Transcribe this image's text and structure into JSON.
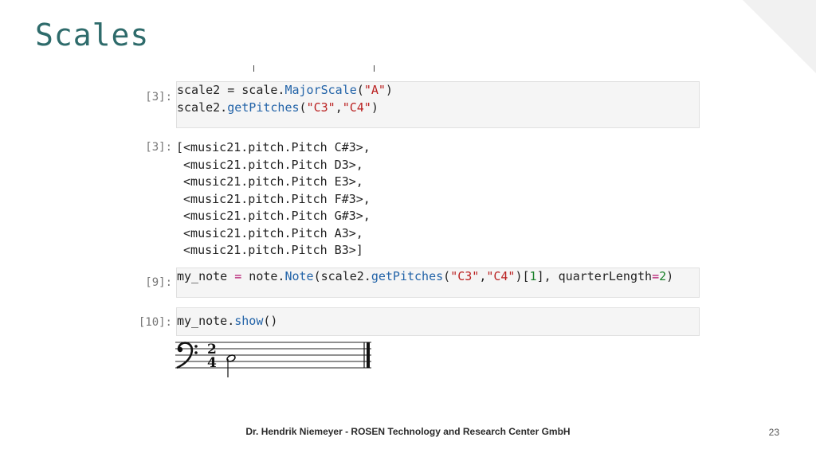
{
  "slide": {
    "title": "Scales",
    "footer": "Dr. Hendrik Niemeyer - ROSEN Technology and Research Center GmbH",
    "page_number": "23"
  },
  "cells": [
    {
      "prompt": "[3]:",
      "type": "input",
      "lines": [
        [
          {
            "t": "scale2 = scale.",
            "c": ""
          },
          {
            "t": "MajorScale",
            "c": "kw"
          },
          {
            "t": "(",
            "c": ""
          },
          {
            "t": "\"A\"",
            "c": "str"
          },
          {
            "t": ")",
            "c": ""
          }
        ],
        [
          {
            "t": "scale2.",
            "c": ""
          },
          {
            "t": "getPitches",
            "c": "kw"
          },
          {
            "t": "(",
            "c": ""
          },
          {
            "t": "\"C3\"",
            "c": "str"
          },
          {
            "t": ",",
            "c": ""
          },
          {
            "t": "\"C4\"",
            "c": "str"
          },
          {
            "t": ")",
            "c": ""
          }
        ]
      ]
    },
    {
      "prompt": "[3]:",
      "type": "output",
      "lines": [
        [
          {
            "t": "[<music21.pitch.Pitch C#3>,",
            "c": ""
          }
        ],
        [
          {
            "t": " <music21.pitch.Pitch D3>,",
            "c": ""
          }
        ],
        [
          {
            "t": " <music21.pitch.Pitch E3>,",
            "c": ""
          }
        ],
        [
          {
            "t": " <music21.pitch.Pitch F#3>,",
            "c": ""
          }
        ],
        [
          {
            "t": " <music21.pitch.Pitch G#3>,",
            "c": ""
          }
        ],
        [
          {
            "t": " <music21.pitch.Pitch A3>,",
            "c": ""
          }
        ],
        [
          {
            "t": " <music21.pitch.Pitch B3>]",
            "c": ""
          }
        ]
      ]
    },
    {
      "prompt": "[9]:",
      "type": "input",
      "lines": [
        [
          {
            "t": "my_note ",
            "c": ""
          },
          {
            "t": "=",
            "c": "op"
          },
          {
            "t": " note.",
            "c": ""
          },
          {
            "t": "Note",
            "c": "kw"
          },
          {
            "t": "(scale2.",
            "c": ""
          },
          {
            "t": "getPitches",
            "c": "kw"
          },
          {
            "t": "(",
            "c": ""
          },
          {
            "t": "\"C3\"",
            "c": "str"
          },
          {
            "t": ",",
            "c": ""
          },
          {
            "t": "\"C4\"",
            "c": "str"
          },
          {
            "t": ")[",
            "c": ""
          },
          {
            "t": "1",
            "c": "num"
          },
          {
            "t": "], quarterLength",
            "c": ""
          },
          {
            "t": "=",
            "c": "op"
          },
          {
            "t": "2",
            "c": "num"
          },
          {
            "t": ")",
            "c": ""
          }
        ]
      ]
    },
    {
      "prompt": "[10]:",
      "type": "input",
      "lines": [
        [
          {
            "t": "my_note.",
            "c": ""
          },
          {
            "t": "show",
            "c": "kw"
          },
          {
            "t": "()",
            "c": ""
          }
        ]
      ]
    }
  ],
  "score": {
    "clef": "bass-clef",
    "time_signature": {
      "top": "2",
      "bottom": "4"
    },
    "note": "half-note"
  }
}
